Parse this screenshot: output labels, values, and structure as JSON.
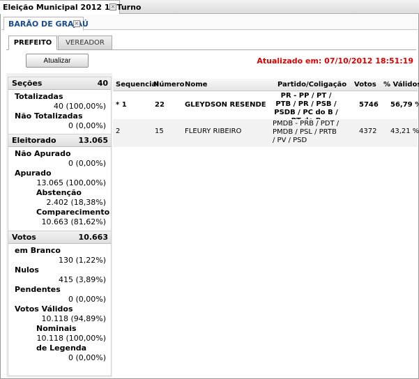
{
  "window_tab": {
    "label": "Eleição Municipal 2012 1º Turno",
    "close": "×"
  },
  "city_tab": {
    "label": "BARÃO DE GRAJAÚ",
    "close": "×"
  },
  "sub_tabs": [
    {
      "label": "PREFEITO",
      "active": true
    },
    {
      "label": "VEREADOR",
      "active": false
    }
  ],
  "toolbar": {
    "refresh_label": "Atualizar",
    "updated_text": "Atualizado em: 07/10/2012 18:51:19"
  },
  "colors": {
    "updated": "#e00000",
    "city_tab": "#1a4c8b"
  },
  "sidebar": {
    "secoes": {
      "title": "Seções",
      "total": "40",
      "totalizadas_label": "Totalizadas",
      "totalizadas_value": "40 (100,00%)",
      "nao_totalizadas_label": "Não Totalizadas",
      "nao_totalizadas_value": "0 (0,00%)"
    },
    "eleitorado": {
      "title": "Eleitorado",
      "total": "13.065",
      "nao_apurado_label": "Não Apurado",
      "nao_apurado_value": "0 (0,00%)",
      "apurado_label": "Apurado",
      "apurado_value": "13.065 (100,00%)",
      "abstencao_label": "Abstenção",
      "abstencao_value": "2.402 (18,38%)",
      "comparecimento_label": "Comparecimento",
      "comparecimento_value": "10.663 (81,62%)"
    },
    "votos": {
      "title": "Votos",
      "total": "10.663",
      "branco_label": "em Branco",
      "branco_value": "130 (1,22%)",
      "nulos_label": "Nulos",
      "nulos_value": "415 (3,89%)",
      "pendentes_label": "Pendentes",
      "pendentes_value": "0 (0,00%)",
      "validos_label": "Votos Válidos",
      "validos_value": "10.118 (94,89%)",
      "nominais_label": "Nominais",
      "nominais_value": "10.118 (100,00%)",
      "legenda_label": "de Legenda",
      "legenda_value": "0 (0,00%)"
    }
  },
  "results": {
    "headers": {
      "seq": "Sequencial",
      "num": "Número",
      "nome": "Nome",
      "partido": "Partido/Coligação",
      "votos": "Votos",
      "validos": "% Válidos"
    },
    "rows": [
      {
        "seq": "* 1",
        "num": "22",
        "nome": "GLEYDSON RESENDE",
        "partido": "PR - PP / PT / PTB / PR / PSB / PSDB / PC do B / PT do B",
        "votos": "5746",
        "validos": "56,79 %"
      },
      {
        "seq": "2",
        "num": "15",
        "nome": "FLEURY RIBEIRO",
        "partido": "PMDB - PRB / PDT / PMDB / PSL / PRTB / PV / PSD",
        "votos": "4372",
        "validos": "43,21 %"
      }
    ]
  }
}
